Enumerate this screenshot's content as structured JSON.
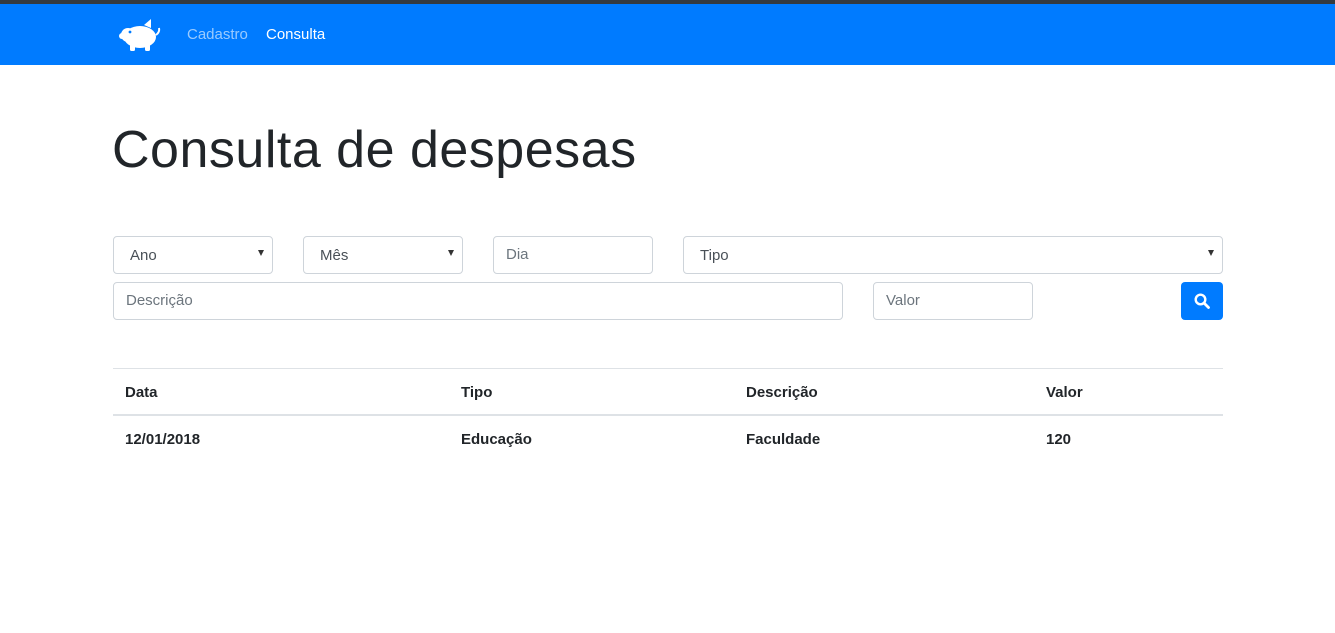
{
  "nav": {
    "brand_icon": "piggy-bank-icon",
    "links": [
      {
        "label": "Cadastro",
        "active": false
      },
      {
        "label": "Consulta",
        "active": true
      }
    ],
    "background": "#007bff"
  },
  "page": {
    "title": "Consulta de despesas"
  },
  "filters": {
    "ano": {
      "selected": "Ano"
    },
    "mes": {
      "selected": "Mês"
    },
    "dia": {
      "placeholder": "Dia",
      "value": ""
    },
    "tipo": {
      "selected": "Tipo"
    },
    "descricao": {
      "placeholder": "Descrição",
      "value": ""
    },
    "valor": {
      "placeholder": "Valor",
      "value": ""
    },
    "search_icon": "search-icon"
  },
  "table": {
    "headers": [
      "Data",
      "Tipo",
      "Descrição",
      "Valor"
    ],
    "rows": [
      [
        "12/01/2018",
        "Educação",
        "Faculdade",
        "120"
      ]
    ]
  }
}
